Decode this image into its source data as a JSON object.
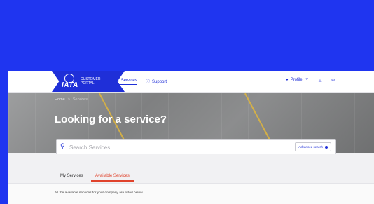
{
  "header": {
    "logo_text": "IATA",
    "logo_subtitle": "CUSTOMER PORTAL",
    "nav_services": "Services",
    "nav_support": "Support",
    "nav_profile": "Profile",
    "nav_profile_caret": "˅"
  },
  "hero": {
    "breadcrumb_home": "Home",
    "breadcrumb_sep": ">",
    "breadcrumb_current": "Services",
    "title": "Looking for a service?"
  },
  "search": {
    "placeholder": "Search Services",
    "advanced_label": "Advanced search"
  },
  "tabs": {
    "my_services": "My Services",
    "available_services": "Available Services"
  },
  "content": {
    "helper_text": "All the available services for your company are listed below."
  },
  "colors": {
    "brand_blue": "#1f35f0",
    "accent_red": "#e0432c"
  },
  "icons": {
    "services": "grid-icon",
    "support": "help-circle-icon",
    "profile": "user-icon",
    "notifications": "bell-icon",
    "search": "search-icon"
  }
}
